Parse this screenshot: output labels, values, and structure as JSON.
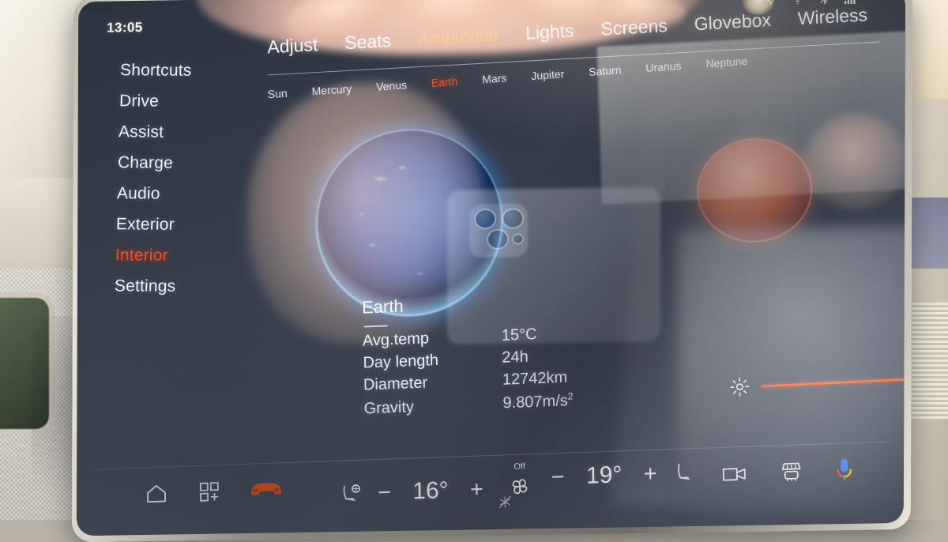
{
  "status": {
    "time": "13:05",
    "icons": [
      {
        "name": "navigation-icon",
        "label": "navigation"
      },
      {
        "name": "wifi-icon",
        "label": "wifi"
      },
      {
        "name": "bluetooth-off-icon",
        "label": "bluetooth off"
      },
      {
        "name": "cellular-signal-icon",
        "label": "signal"
      }
    ]
  },
  "sidebar": {
    "items": [
      {
        "label": "Shortcuts",
        "active": false
      },
      {
        "label": "Drive",
        "active": false
      },
      {
        "label": "Assist",
        "active": false
      },
      {
        "label": "Charge",
        "active": false
      },
      {
        "label": "Audio",
        "active": false
      },
      {
        "label": "Exterior",
        "active": false
      },
      {
        "label": "Interior",
        "active": true
      },
      {
        "label": "Settings",
        "active": false
      }
    ]
  },
  "tabs": [
    {
      "label": "Adjust",
      "active": false
    },
    {
      "label": "Seats",
      "active": false
    },
    {
      "label": "Ambience",
      "active": true
    },
    {
      "label": "Lights",
      "active": false
    },
    {
      "label": "Screens",
      "active": false
    },
    {
      "label": "Glovebox",
      "active": false
    },
    {
      "label": "Wireless",
      "active": false
    }
  ],
  "planets": [
    {
      "label": "Sun",
      "active": false
    },
    {
      "label": "Mercury",
      "active": false
    },
    {
      "label": "Venus",
      "active": false
    },
    {
      "label": "Earth",
      "active": true
    },
    {
      "label": "Mars",
      "active": false
    },
    {
      "label": "Jupiter",
      "active": false
    },
    {
      "label": "Saturn",
      "active": false
    },
    {
      "label": "Uranus",
      "active": false
    },
    {
      "label": "Neptune",
      "active": false
    }
  ],
  "info": {
    "title": "Earth",
    "rows": [
      {
        "key": "Avg.temp",
        "value": "15°C"
      },
      {
        "key": "Day length",
        "value": "24h"
      },
      {
        "key": "Diameter",
        "value": "12742km"
      },
      {
        "key": "Gravity",
        "value": "9.807m/s",
        "sup": "2"
      }
    ]
  },
  "brightness": {
    "icon": "brightness-sun-icon",
    "value": 100,
    "accent": "#ff4d15"
  },
  "bottom_bar": {
    "home_label": "home",
    "apps_label": "apps-add",
    "car_label": "vehicle",
    "left_climate": {
      "seat_icon": "driver-seat-heat-icon",
      "minus": "−",
      "temperature": "16°",
      "plus": "+"
    },
    "fan": {
      "state_label": "Off",
      "icon": "fan-icon",
      "ac_icon": "ac-off-icon"
    },
    "right_climate": {
      "minus": "−",
      "temperature": "19°",
      "plus": "+",
      "seat_icon": "passenger-seat-icon"
    },
    "right_icons": [
      {
        "name": "dashcam-icon",
        "label": "dashcam"
      },
      {
        "name": "rear-defrost-icon",
        "label": "rear defrost"
      },
      {
        "name": "voice-assistant-icon",
        "label": "voice assistant"
      }
    ]
  },
  "theme": {
    "accent": "#ff4d15",
    "text": "#edf0f4",
    "screen_bg": "#373f4d"
  }
}
